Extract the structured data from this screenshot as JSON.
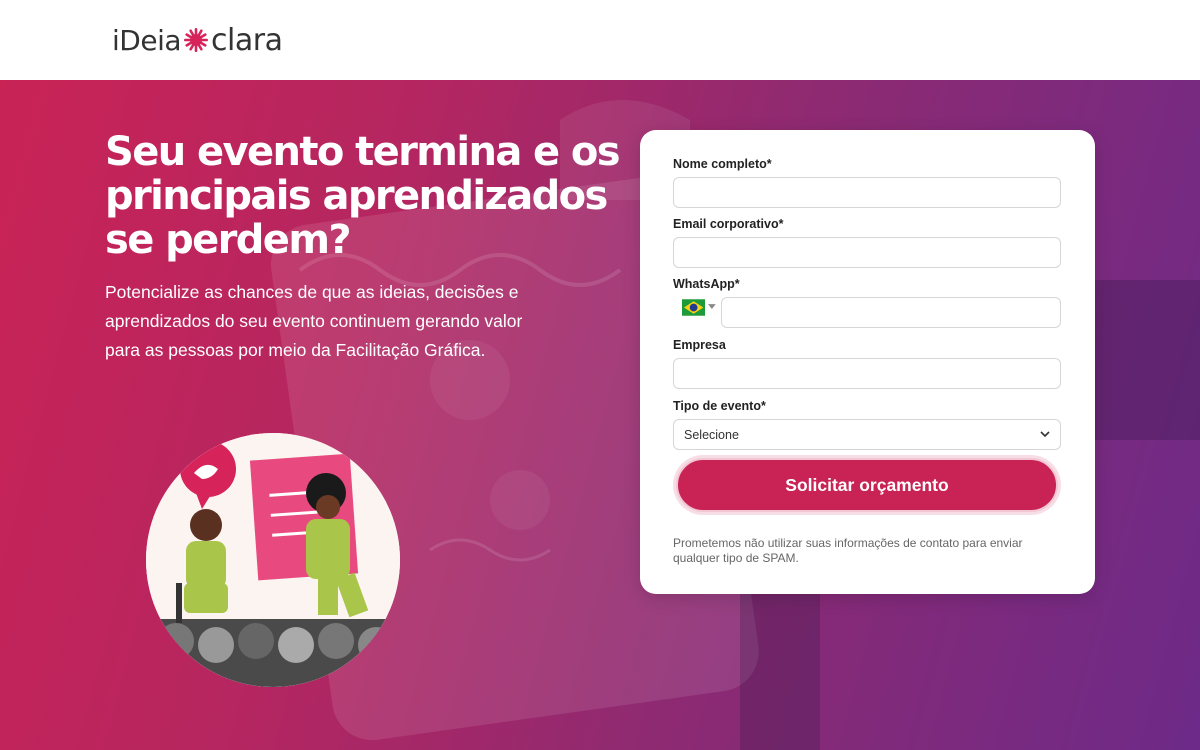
{
  "brand": {
    "logo_part1": "iDeia",
    "logo_part2": "clara"
  },
  "hero": {
    "headline": "Seu evento termina e os principais aprendizados se perdem?",
    "subtext": "Potencialize as chances de que as ideias, decisões e aprendizados do seu evento continuem gerando valor para as pessoas por meio da Facilitação Gráfica."
  },
  "form": {
    "name_label": "Nome completo*",
    "name_value": "",
    "email_label": "Email corporativo*",
    "email_value": "",
    "whatsapp_label": "WhatsApp*",
    "whatsapp_value": "",
    "whatsapp_country": "BR",
    "company_label": "Empresa",
    "company_value": "",
    "event_type_label": "Tipo de evento*",
    "event_type_selected": "Selecione",
    "submit_label": "Solicitar orçamento",
    "disclaimer": "Prometemos não utilizar suas informações de contato para enviar qualquer tipo de SPAM."
  },
  "colors": {
    "accent": "#c92356",
    "gradient_start": "#c92356",
    "gradient_end": "#6d2a88"
  },
  "icons": [
    "flower-logo-icon",
    "brazil-flag-icon",
    "chevron-down-icon"
  ]
}
